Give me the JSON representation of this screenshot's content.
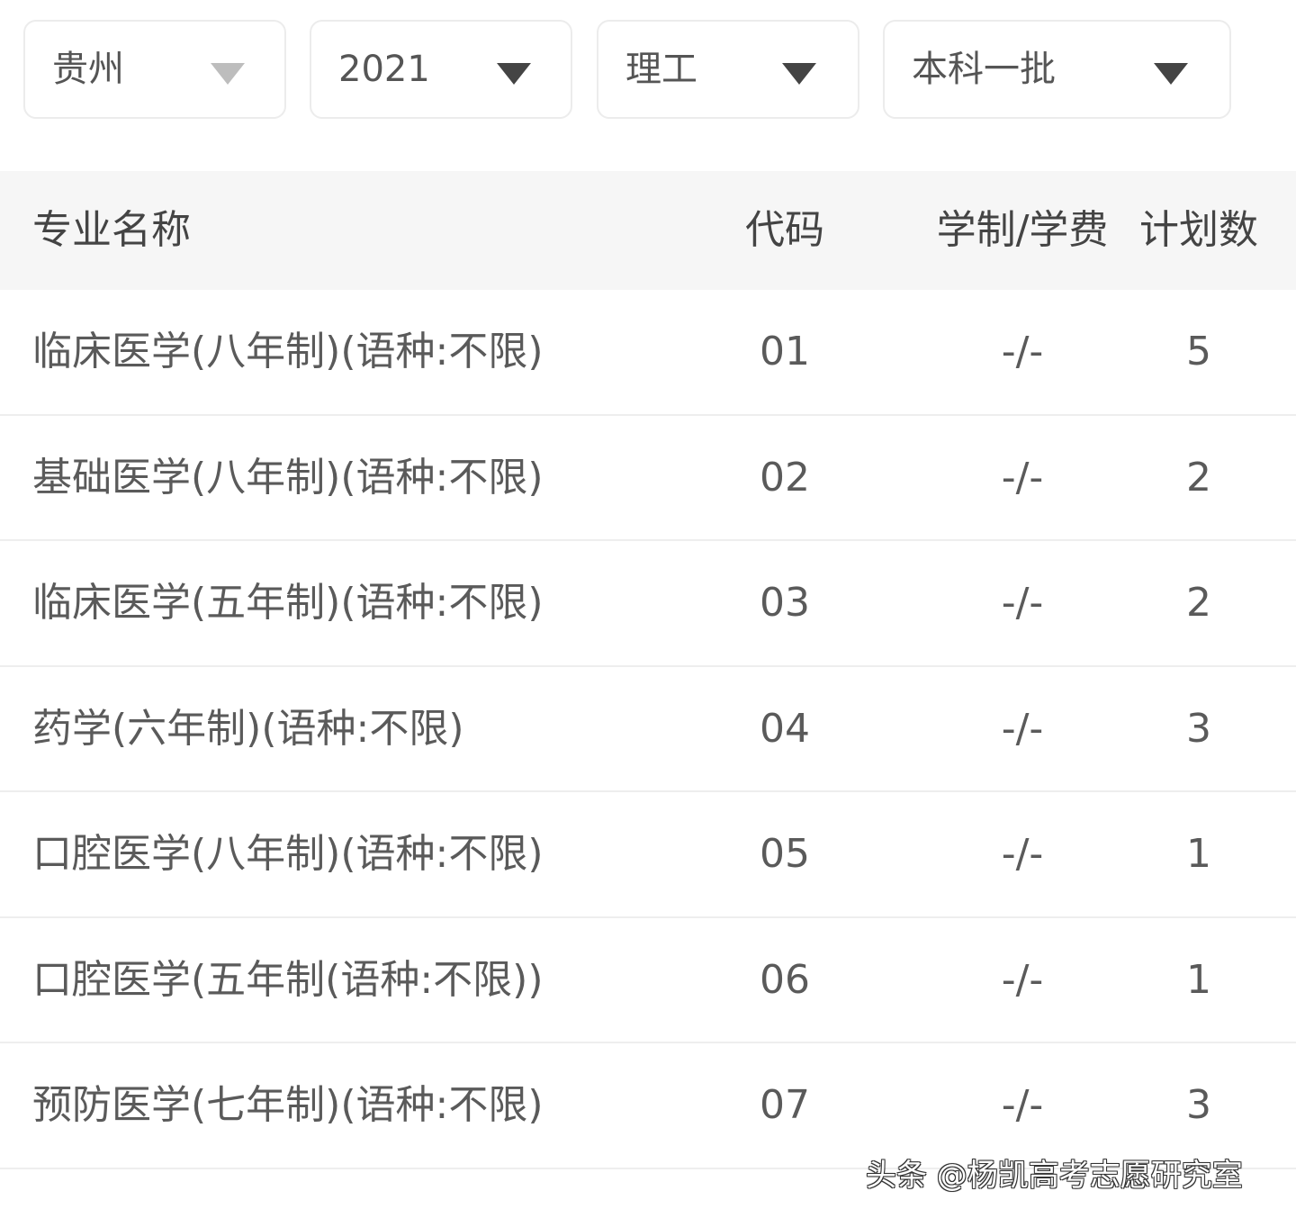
{
  "filters": [
    {
      "value": "贵州",
      "caret": "chevron-down-icon"
    },
    {
      "value": "2021",
      "caret": "chevron-down-icon"
    },
    {
      "value": "理工",
      "caret": "chevron-down-icon"
    },
    {
      "value": "本科一批",
      "caret": "chevron-down-icon"
    }
  ],
  "table": {
    "headers": {
      "name": "专业名称",
      "code": "代码",
      "fee": "学制/学费",
      "plan": "计划数"
    },
    "rows": [
      {
        "name": "临床医学(八年制)(语种:不限)",
        "code": "01",
        "fee": "-/-",
        "plan": "5"
      },
      {
        "name": "基础医学(八年制)(语种:不限)",
        "code": "02",
        "fee": "-/-",
        "plan": "2"
      },
      {
        "name": "临床医学(五年制)(语种:不限)",
        "code": "03",
        "fee": "-/-",
        "plan": "2"
      },
      {
        "name": "药学(六年制)(语种:不限)",
        "code": "04",
        "fee": "-/-",
        "plan": "3"
      },
      {
        "name": "口腔医学(八年制)(语种:不限)",
        "code": "05",
        "fee": "-/-",
        "plan": "1"
      },
      {
        "name": "口腔医学(五年制(语种:不限))",
        "code": "06",
        "fee": "-/-",
        "plan": "1"
      },
      {
        "name": "预防医学(七年制)(语种:不限)",
        "code": "07",
        "fee": "-/-",
        "plan": "3"
      }
    ]
  },
  "watermark": "头条 @杨凯高考志愿研究室"
}
